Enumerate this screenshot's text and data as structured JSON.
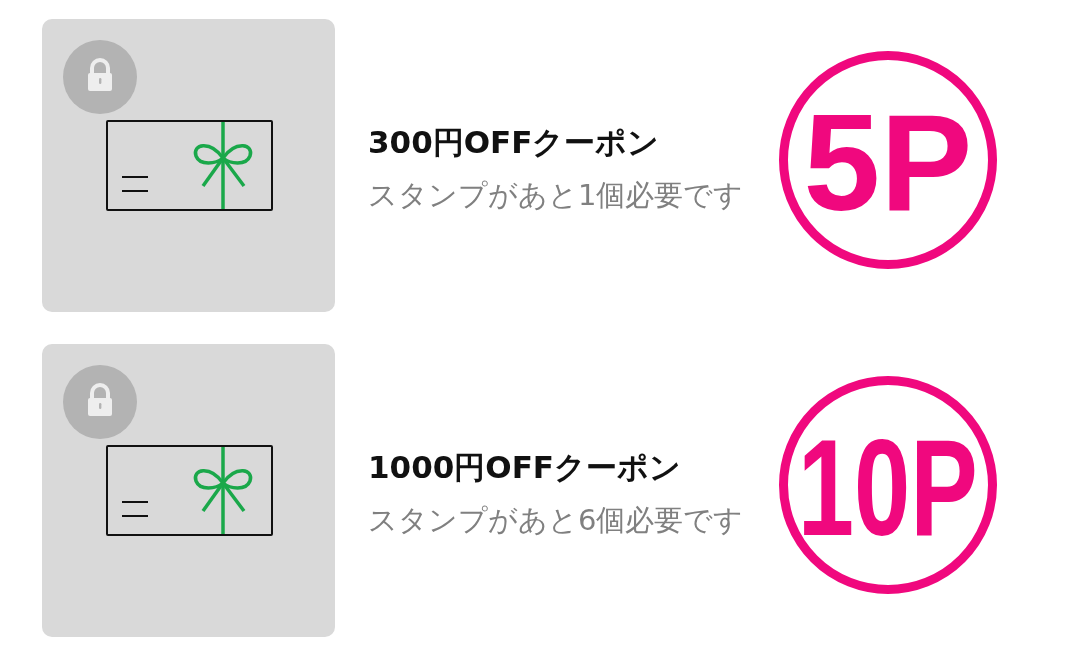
{
  "coupons": [
    {
      "locked": true,
      "title": "300円OFFクーポン",
      "note": "スタンプがあと1個必要です",
      "points": "5P"
    },
    {
      "locked": true,
      "title": "1000円OFFクーポン",
      "note": "スタンプがあと6個必要です",
      "points": "10P"
    }
  ]
}
